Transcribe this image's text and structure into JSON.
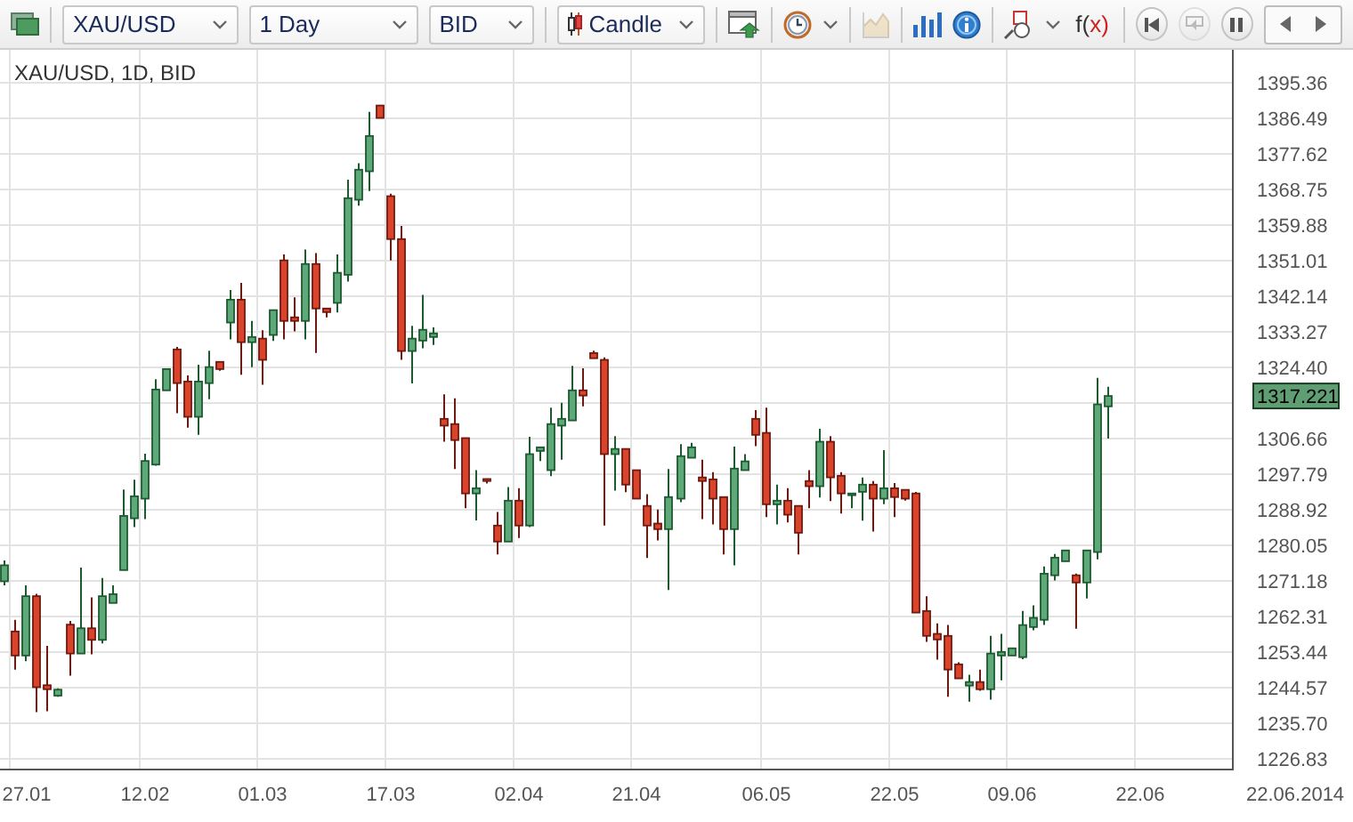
{
  "toolbar": {
    "selectors": [
      {
        "value": "XAU/USD"
      },
      {
        "value": "1 Day"
      },
      {
        "value": "BID"
      }
    ],
    "chart_type": {
      "value": "Candle"
    },
    "icon_buttons": [
      {
        "kind": "window",
        "disabled": false
      },
      {
        "kind": "clock",
        "disabled": false
      },
      {
        "kind": "chart",
        "disabled": true
      },
      {
        "kind": "bars",
        "disabled": false
      },
      {
        "kind": "info",
        "disabled": false
      },
      {
        "kind": "shapes",
        "disabled": false
      }
    ],
    "function_button": {
      "label": "f(x)"
    },
    "playback": [
      {
        "kind": "rewind",
        "disabled": false
      },
      {
        "kind": "replay",
        "disabled": true
      },
      {
        "kind": "pause",
        "disabled": false
      }
    ]
  },
  "chart": {
    "title": "XAU/USD, 1D, BID",
    "price_badge": "1317.221",
    "axis_end_label": "22.06.2014",
    "chart_data": {
      "type": "candlestick",
      "grid": true,
      "ylim": [
        1224.31,
        1403.48
      ],
      "yticks": [
        {
          "value": 1395.36,
          "label": "1395.36"
        },
        {
          "value": 1386.49,
          "label": "1386.49"
        },
        {
          "value": 1377.62,
          "label": "1377.62"
        },
        {
          "value": 1368.75,
          "label": "1368.75"
        },
        {
          "value": 1359.88,
          "label": "1359.88"
        },
        {
          "value": 1351.01,
          "label": "1351.01"
        },
        {
          "value": 1342.14,
          "label": "1342.14"
        },
        {
          "value": 1333.27,
          "label": "1333.27"
        },
        {
          "value": 1324.4,
          "label": "1324.40"
        },
        {
          "value": 1306.66,
          "label": "1306.66"
        },
        {
          "value": 1297.79,
          "label": "1297.79"
        },
        {
          "value": 1288.92,
          "label": "1288.92"
        },
        {
          "value": 1280.05,
          "label": "1280.05"
        },
        {
          "value": 1271.18,
          "label": "1271.18"
        },
        {
          "value": 1262.31,
          "label": "1262.31"
        },
        {
          "value": 1253.44,
          "label": "1253.44"
        },
        {
          "value": 1244.57,
          "label": "1244.57"
        },
        {
          "value": 1235.7,
          "label": "1235.70"
        },
        {
          "value": 1226.83,
          "label": "1226.83"
        }
      ],
      "categories": [
        null,
        "27.01",
        null,
        null,
        null,
        null,
        null,
        null,
        null,
        null,
        null,
        null,
        null,
        "12.02",
        null,
        null,
        null,
        null,
        null,
        null,
        null,
        null,
        null,
        null,
        "01.03",
        null,
        null,
        null,
        null,
        null,
        null,
        null,
        null,
        null,
        null,
        null,
        "17.03",
        null,
        null,
        null,
        null,
        null,
        null,
        null,
        null,
        null,
        null,
        null,
        "02.04",
        null,
        null,
        null,
        null,
        null,
        null,
        null,
        null,
        null,
        null,
        "21.04",
        null,
        null,
        null,
        null,
        null,
        null,
        null,
        null,
        null,
        null,
        null,
        "06.05",
        null,
        null,
        null,
        null,
        null,
        null,
        null,
        null,
        null,
        null,
        null,
        "22.05",
        null,
        null,
        null,
        null,
        null,
        null,
        null,
        null,
        null,
        null,
        "09.06",
        null,
        null,
        null,
        null,
        null,
        null,
        null,
        null,
        null,
        null,
        null,
        "22.06",
        null,
        null,
        null,
        null,
        null,
        null,
        null,
        null
      ],
      "ohlc": [
        [
          1271.0,
          1276.2,
          1270.0,
          1275.0
        ],
        [
          1258.5,
          1261.4,
          1249.0,
          1252.5
        ],
        [
          1252.5,
          1270.0,
          1251.1,
          1267.3
        ],
        [
          1267.3,
          1267.9,
          1238.4,
          1244.6
        ],
        [
          1245.1,
          1254.9,
          1238.6,
          1244.1
        ],
        [
          1242.5,
          1244.3,
          1242.2,
          1244.0
        ],
        [
          1260.2,
          1261.1,
          1247.5,
          1253.0
        ],
        [
          1253.0,
          1274.4,
          1253.0,
          1259.3
        ],
        [
          1259.3,
          1267.0,
          1252.8,
          1256.4
        ],
        [
          1256.4,
          1271.8,
          1255.5,
          1267.3
        ],
        [
          1265.6,
          1270.0,
          1265.6,
          1267.8
        ],
        [
          1273.8,
          1293.9,
          1273.8,
          1287.3
        ],
        [
          1286.7,
          1296.3,
          1284.5,
          1292.2
        ],
        [
          1291.6,
          1302.8,
          1286.5,
          1301.0
        ],
        [
          1300.1,
          1321.4,
          1299.8,
          1318.8
        ],
        [
          1318.6,
          1323.9,
          1318.6,
          1323.9
        ],
        [
          1328.8,
          1329.4,
          1312.9,
          1320.4
        ],
        [
          1320.8,
          1322.3,
          1309.3,
          1312.0
        ],
        [
          1312.0,
          1325.0,
          1307.5,
          1320.8
        ],
        [
          1320.4,
          1328.5,
          1316.4,
          1324.4
        ],
        [
          1325.7,
          1325.7,
          1323.5,
          1323.9
        ],
        [
          1335.5,
          1343.6,
          1331.3,
          1341.2
        ],
        [
          1341.2,
          1345.4,
          1322.5,
          1330.6
        ],
        [
          1330.6,
          1335.9,
          1324.4,
          1331.9
        ],
        [
          1331.5,
          1333.6,
          1320.0,
          1326.2
        ],
        [
          1332.4,
          1338.6,
          1330.9,
          1338.6
        ],
        [
          1351.0,
          1352.5,
          1331.3,
          1335.9
        ],
        [
          1336.8,
          1341.8,
          1333.3,
          1335.9
        ],
        [
          1335.9,
          1353.7,
          1331.3,
          1350.1
        ],
        [
          1350.1,
          1352.8,
          1327.9,
          1339.0
        ],
        [
          1339.0,
          1339.0,
          1336.8,
          1338.1
        ],
        [
          1340.4,
          1352.5,
          1338.0,
          1347.9
        ],
        [
          1347.4,
          1371.1,
          1345.7,
          1366.5
        ],
        [
          1366.1,
          1375.2,
          1364.6,
          1373.6
        ],
        [
          1373.2,
          1388.0,
          1368.3,
          1382.0
        ],
        [
          1389.6,
          1389.6,
          1386.5,
          1386.5
        ],
        [
          1367.0,
          1367.6,
          1351.0,
          1356.3
        ],
        [
          1356.3,
          1359.6,
          1326.2,
          1328.4
        ],
        [
          1328.4,
          1334.7,
          1320.3,
          1331.5
        ],
        [
          1331.0,
          1342.4,
          1329.1,
          1333.7
        ],
        [
          1331.9,
          1334.3,
          1329.9,
          1332.8
        ],
        [
          1311.5,
          1317.6,
          1305.8,
          1309.8
        ],
        [
          1310.2,
          1316.6,
          1299.0,
          1306.2
        ],
        [
          1306.7,
          1306.7,
          1289.2,
          1292.9
        ],
        [
          1292.9,
          1298.7,
          1286.2,
          1294.2
        ],
        [
          1296.5,
          1296.5,
          1295.4,
          1296.0
        ],
        [
          1284.9,
          1288.3,
          1277.7,
          1280.9
        ],
        [
          1280.9,
          1294.5,
          1280.9,
          1291.1
        ],
        [
          1291.1,
          1294.2,
          1281.8,
          1284.9
        ],
        [
          1284.9,
          1307.0,
          1284.5,
          1302.7
        ],
        [
          1303.5,
          1304.4,
          1301.0,
          1304.4
        ],
        [
          1298.7,
          1314.3,
          1297.2,
          1310.2
        ],
        [
          1309.8,
          1315.5,
          1301.3,
          1311.5
        ],
        [
          1311.1,
          1324.7,
          1311.1,
          1318.6
        ],
        [
          1318.6,
          1324.1,
          1314.6,
          1317.3
        ],
        [
          1327.9,
          1328.5,
          1326.6,
          1326.6
        ],
        [
          1326.2,
          1326.8,
          1284.9,
          1302.7
        ],
        [
          1302.7,
          1307.2,
          1293.6,
          1304.0
        ],
        [
          1304.0,
          1304.0,
          1293.2,
          1295.1
        ],
        [
          1298.7,
          1298.7,
          1291.6,
          1291.6
        ],
        [
          1289.8,
          1292.7,
          1276.8,
          1284.9
        ],
        [
          1285.4,
          1288.9,
          1281.2,
          1284.0
        ],
        [
          1284.0,
          1299.0,
          1268.8,
          1292.0
        ],
        [
          1291.6,
          1305.2,
          1290.7,
          1302.2
        ],
        [
          1301.8,
          1305.5,
          1301.8,
          1304.4
        ],
        [
          1296.9,
          1301.3,
          1286.5,
          1296.0
        ],
        [
          1296.4,
          1298.2,
          1285.2,
          1291.6
        ],
        [
          1292.0,
          1292.0,
          1277.7,
          1284.0
        ],
        [
          1284.0,
          1304.6,
          1275.0,
          1299.1
        ],
        [
          1298.7,
          1302.7,
          1298.7,
          1300.9
        ],
        [
          1311.5,
          1313.7,
          1304.7,
          1307.5
        ],
        [
          1308.0,
          1314.3,
          1287.0,
          1290.2
        ],
        [
          1290.2,
          1295.1,
          1285.2,
          1291.1
        ],
        [
          1291.1,
          1294.2,
          1285.7,
          1287.6
        ],
        [
          1289.8,
          1289.8,
          1277.7,
          1283.1
        ],
        [
          1296.0,
          1298.7,
          1289.2,
          1294.7
        ],
        [
          1294.7,
          1309.0,
          1291.9,
          1305.8
        ],
        [
          1305.8,
          1307.2,
          1291.0,
          1296.9
        ],
        [
          1297.3,
          1298.2,
          1287.9,
          1292.9
        ],
        [
          1292.5,
          1292.9,
          1289.2,
          1292.9
        ],
        [
          1293.3,
          1296.9,
          1286.1,
          1295.1
        ],
        [
          1295.1,
          1296.0,
          1283.4,
          1291.6
        ],
        [
          1291.6,
          1303.7,
          1290.2,
          1294.2
        ],
        [
          1294.2,
          1295.5,
          1287.0,
          1292.0
        ],
        [
          1293.8,
          1293.8,
          1291.1,
          1291.6
        ],
        [
          1292.9,
          1293.3,
          1263.2,
          1263.2
        ],
        [
          1263.6,
          1267.3,
          1255.9,
          1257.4
        ],
        [
          1257.9,
          1260.5,
          1251.5,
          1256.5
        ],
        [
          1257.4,
          1260.1,
          1242.2,
          1249.0
        ],
        [
          1250.3,
          1250.8,
          1246.8,
          1246.8
        ],
        [
          1245.0,
          1247.7,
          1241.0,
          1245.9
        ],
        [
          1245.9,
          1249.0,
          1243.7,
          1244.1
        ],
        [
          1244.1,
          1257.4,
          1241.5,
          1253.0
        ],
        [
          1252.5,
          1257.9,
          1246.3,
          1253.4
        ],
        [
          1252.5,
          1254.3,
          1252.5,
          1254.3
        ],
        [
          1252.1,
          1263.6,
          1251.6,
          1260.1
        ],
        [
          1259.6,
          1265.0,
          1258.8,
          1261.9
        ],
        [
          1261.4,
          1274.7,
          1260.1,
          1272.9
        ],
        [
          1272.5,
          1277.8,
          1271.2,
          1276.9
        ],
        [
          1276.0,
          1278.7,
          1276.0,
          1278.7
        ],
        [
          1272.5,
          1272.9,
          1259.2,
          1270.7
        ],
        [
          1270.7,
          1278.7,
          1266.7,
          1278.7
        ],
        [
          1278.3,
          1321.7,
          1276.5,
          1315.1
        ],
        [
          1314.6,
          1319.5,
          1306.6,
          1317.2
        ],
        null,
        null,
        null,
        null,
        null,
        null,
        null,
        null,
        null,
        null,
        null
      ]
    }
  }
}
